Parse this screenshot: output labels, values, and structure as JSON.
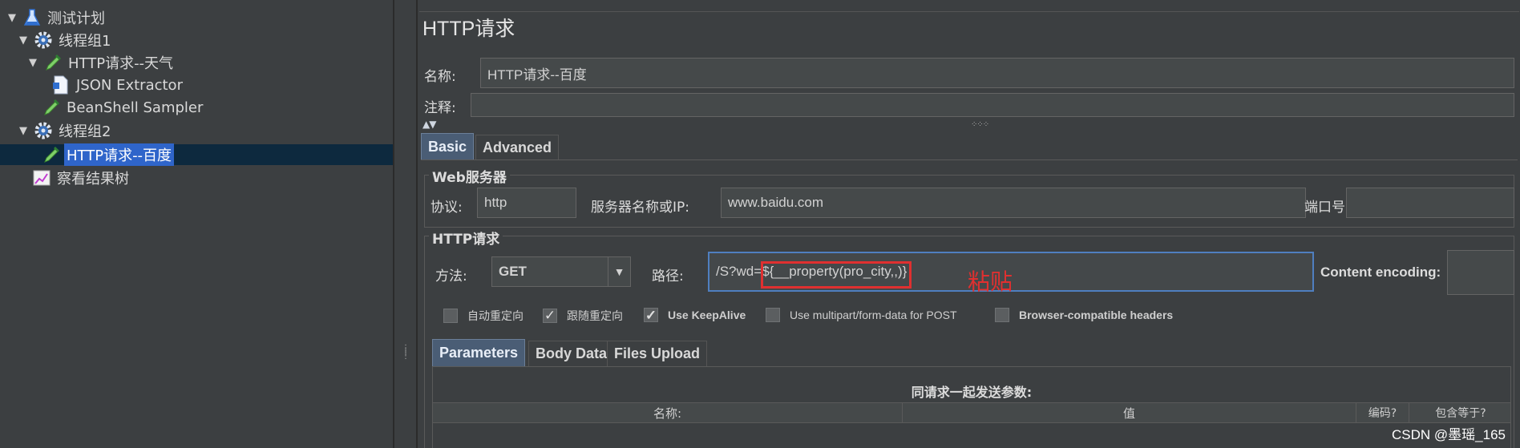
{
  "tree": {
    "items": [
      {
        "label": "测试计划",
        "icon": "flask-icon"
      },
      {
        "label": "线程组1",
        "icon": "gear-icon"
      },
      {
        "label": "HTTP请求--天气",
        "icon": "pipette-icon"
      },
      {
        "label": "JSON Extractor",
        "icon": "document-icon"
      },
      {
        "label": "BeanShell Sampler",
        "icon": "pipette-icon"
      },
      {
        "label": "线程组2",
        "icon": "gear-icon"
      },
      {
        "label": "HTTP请求--百度",
        "icon": "pipette-icon"
      },
      {
        "label": "察看结果树",
        "icon": "chart-icon"
      }
    ]
  },
  "panel": {
    "title": "HTTP请求",
    "name_label": "名称:",
    "name_value": "HTTP请求--百度",
    "comment_label": "注释:",
    "comment_value": ""
  },
  "tabs": {
    "basic": "Basic",
    "advanced": "Advanced"
  },
  "web_server": {
    "group_title": "Web服务器",
    "protocol_label": "协议:",
    "protocol_value": "http",
    "server_label": "服务器名称或IP:",
    "server_value": "www.baidu.com",
    "port_label": "端口号:",
    "port_value": ""
  },
  "http_request": {
    "group_title": "HTTP请求",
    "method_label": "方法:",
    "method_value": "GET",
    "path_label": "路径:",
    "path_prefix": "/S?wd=",
    "path_highlighted": "${__property(pro_city,,)}",
    "annotation": "粘贴",
    "encoding_label": "Content encoding:",
    "encoding_value": ""
  },
  "options": [
    {
      "label": "自动重定向",
      "checked": false
    },
    {
      "label": "跟随重定向",
      "checked": true
    },
    {
      "label": "Use KeepAlive",
      "checked": true
    },
    {
      "label": "Use multipart/form-data for POST",
      "checked": false
    },
    {
      "label": "Browser-compatible headers",
      "checked": false
    }
  ],
  "subtabs": {
    "parameters": "Parameters",
    "body_data": "Body Data",
    "files_upload": "Files Upload"
  },
  "params_table": {
    "caption": "同请求一起发送参数:",
    "columns": [
      "名称:",
      "值",
      "编码?",
      "包含等于?"
    ]
  },
  "watermark": "CSDN @墨瑶_165",
  "colors": {
    "selection": "#2f65ca",
    "active_tab": "#4a5d75",
    "highlight_box": "#e03030",
    "annotation": "#e03030"
  }
}
